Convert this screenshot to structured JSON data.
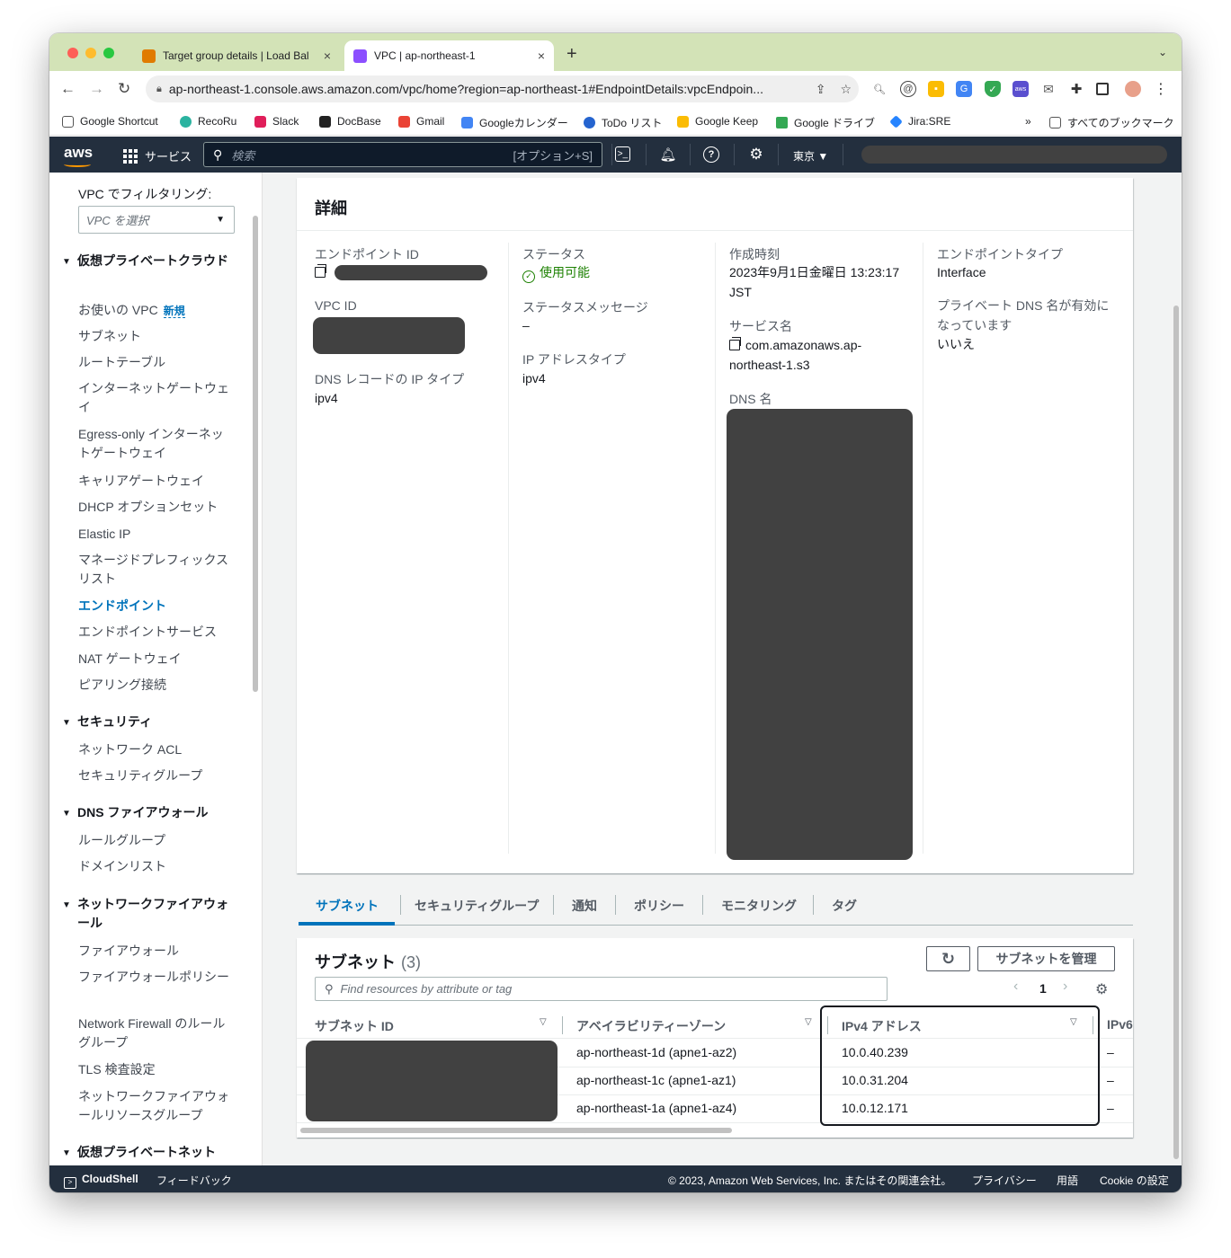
{
  "browser": {
    "tabs": [
      {
        "title": "Target group details | Load Bal",
        "close": "×"
      },
      {
        "title": "VPC | ap-northeast-1",
        "close": "×"
      }
    ],
    "new_tab": "+",
    "url": "ap-northeast-1.console.aws.amazon.com/vpc/home?region=ap-northeast-1#EndpointDetails:vpcEndpoin...",
    "bookmarks": [
      "Google Shortcut",
      "RecoRu",
      "Slack",
      "DocBase",
      "Gmail",
      "Googleカレンダー",
      "ToDo リスト",
      "Google Keep",
      "Google ドライブ",
      "Jira:SRE"
    ],
    "bookmarks_more": "»",
    "all_bookmarks": "すべてのブックマーク"
  },
  "awsnav": {
    "services": "サービス",
    "search_placeholder": "検索",
    "shortcut": "[オプション+S]",
    "region": "東京 ▼"
  },
  "sidebar": {
    "filter_label": "VPC でフィルタリング:",
    "filter_placeholder": "VPC を選択",
    "sections": [
      {
        "title": "仮想プライベートクラウド",
        "items": [
          "お使いの VPC",
          "サブネット",
          "ルートテーブル",
          "インターネットゲートウェイ",
          "Egress-only インターネットゲートウェイ",
          "キャリアゲートウェイ",
          "DHCP オプションセット",
          "Elastic IP",
          "マネージドプレフィックスリスト",
          "エンドポイント",
          "エンドポイントサービス",
          "NAT ゲートウェイ",
          "ピアリング接続"
        ]
      },
      {
        "title": "セキュリティ",
        "items": [
          "ネットワーク ACL",
          "セキュリティグループ"
        ]
      },
      {
        "title": "DNS ファイアウォール",
        "items": [
          "ルールグループ",
          "ドメインリスト"
        ]
      },
      {
        "title": "ネットワークファイアウォール",
        "items": [
          "ファイアウォール",
          "ファイアウォールポリシー",
          "Network Firewall のルールグループ",
          "TLS 検査設定",
          "ネットワークファイアウォールリソースグループ"
        ]
      },
      {
        "title": "仮想プライベートネット",
        "items": []
      }
    ],
    "new_badge": "新規"
  },
  "details": {
    "title": "詳細",
    "endpoint_id_label": "エンドポイント ID",
    "vpc_id_label": "VPC ID",
    "dns_record_ip_type_label": "DNS レコードの IP タイプ",
    "dns_record_ip_type": "ipv4",
    "status_label": "ステータス",
    "status": "使用可能",
    "status_message_label": "ステータスメッセージ",
    "status_message": "–",
    "ip_address_type_label": "IP アドレスタイプ",
    "ip_address_type": "ipv4",
    "created_label": "作成時刻",
    "created": "2023年9月1日金曜日 13:23:17 JST",
    "service_name_label": "サービス名",
    "service_name": "com.amazonaws.ap-northeast-1.s3",
    "dns_name_label": "DNS 名",
    "endpoint_type_label": "エンドポイントタイプ",
    "endpoint_type": "Interface",
    "private_dns_label": "プライベート DNS 名が有効になっています",
    "private_dns": "いいえ"
  },
  "tabs": [
    "サブネット",
    "セキュリティグループ",
    "通知",
    "ポリシー",
    "モニタリング",
    "タグ"
  ],
  "subnets": {
    "title": "サブネット",
    "count": "(3)",
    "manage_button": "サブネットを管理",
    "search_placeholder": "Find resources by attribute or tag",
    "page": "1",
    "columns": [
      "サブネット ID",
      "アベイラビリティーゾーン",
      "IPv4 アドレス",
      "IPv6"
    ],
    "rows": [
      {
        "az": "ap-northeast-1d (apne1-az2)",
        "ipv4": "10.0.40.239",
        "ipv6": "–"
      },
      {
        "az": "ap-northeast-1c (apne1-az1)",
        "ipv4": "10.0.31.204",
        "ipv6": "–"
      },
      {
        "az": "ap-northeast-1a (apne1-az4)",
        "ipv4": "10.0.12.171",
        "ipv6": "–"
      }
    ]
  },
  "footer": {
    "cloudshell": "CloudShell",
    "feedback": "フィードバック",
    "copyright": "© 2023, Amazon Web Services, Inc. またはその関連会社。",
    "privacy": "プライバシー",
    "terms": "用語",
    "cookie": "Cookie の設定"
  }
}
